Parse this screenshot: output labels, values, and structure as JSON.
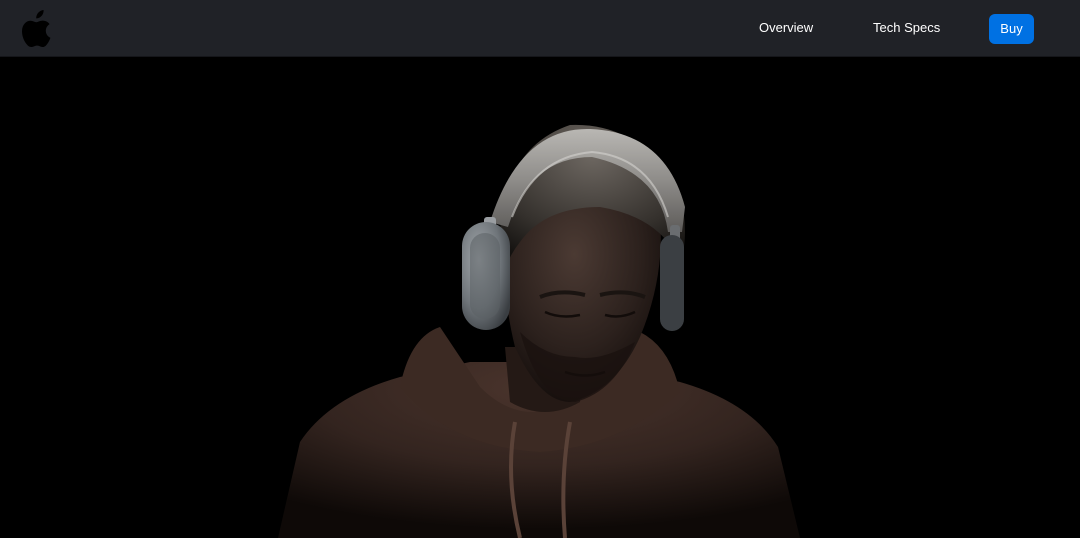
{
  "navbar": {
    "logo_icon": "apple-logo-icon",
    "links": {
      "overview": "Overview",
      "tech_specs": "Tech Specs"
    },
    "buy_label": "Buy"
  },
  "colors": {
    "navbar_bg": "#202227",
    "accent": "#0071e3",
    "hero_bg": "#000000",
    "link_text": "#ffffff"
  },
  "hero": {
    "image_subject": "person-wearing-headphones-icon"
  }
}
